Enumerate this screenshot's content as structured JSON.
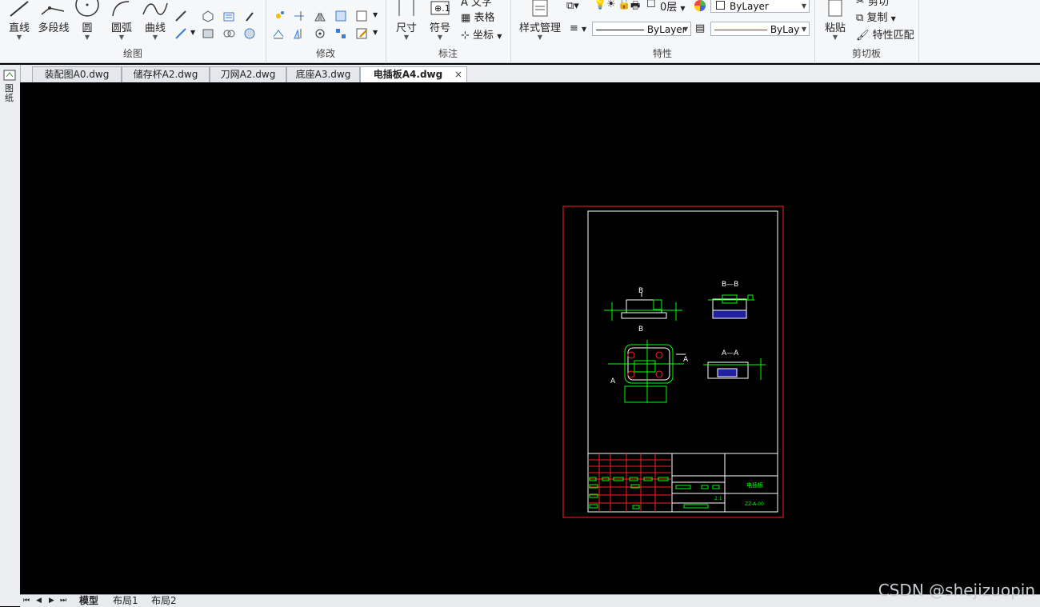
{
  "ribbon": {
    "draw": {
      "label": "绘图",
      "line": "直线",
      "polyline": "多段线",
      "circle": "圆",
      "arc": "圆弧",
      "curve": "曲线"
    },
    "modify": {
      "label": "修改"
    },
    "annotate": {
      "label": "标注",
      "dimension": "尺寸",
      "symbol": "符号",
      "text": "文字",
      "table": "表格",
      "coords": "坐标"
    },
    "properties": {
      "label": "特性",
      "style_manager": "样式管理",
      "layer_value": "0层",
      "color_value": "ByLayer",
      "linetype_value": "ByLayer",
      "lineweight_value": "ByLay"
    },
    "clipboard": {
      "label": "剪切板",
      "paste": "粘贴",
      "cut": "剪切",
      "copy": "复制",
      "match": "特性匹配"
    }
  },
  "tabs": [
    {
      "label": "装配图A0.dwg"
    },
    {
      "label": "储存杯A2.dwg"
    },
    {
      "label": "刀网A2.dwg"
    },
    {
      "label": "底座A3.dwg"
    },
    {
      "label": "电插板A4.dwg",
      "close": "×"
    }
  ],
  "left_panel": {
    "label": "图纸"
  },
  "layout_tabs": {
    "model": "模型",
    "layout1": "布局1",
    "layout2": "布局2"
  },
  "drawing": {
    "section_bb": "B—B",
    "section_aa": "A—A",
    "mark_b": "B",
    "mark_a": "A",
    "title_name": "电插板",
    "title_code": "ZZ-A-00",
    "scale": "2:1"
  },
  "watermark": "CSDN @shejizuopin",
  "colors": {
    "drawing_green": "#00ff00",
    "drawing_red": "#ff2020",
    "frame_white": "#ffffff",
    "fill_blue": "#2020a0"
  }
}
